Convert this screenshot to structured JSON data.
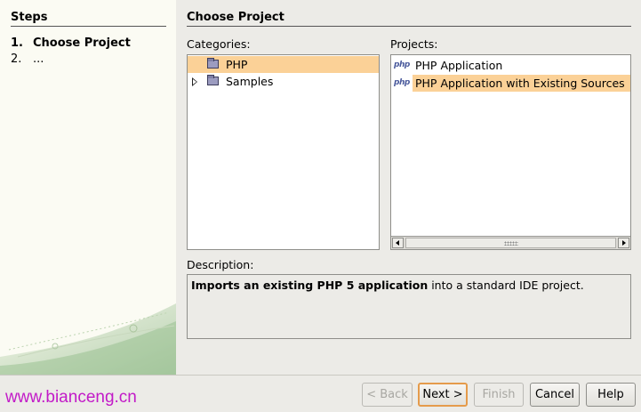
{
  "steps": {
    "title": "Steps",
    "items": [
      {
        "num": "1.",
        "label": "Choose Project"
      },
      {
        "num": "2.",
        "label": "..."
      }
    ]
  },
  "panel": {
    "title": "Choose Project",
    "categories_label": "Categories:",
    "projects_label": "Projects:",
    "description_label": "Description:"
  },
  "categories": [
    {
      "label": "PHP",
      "selected": true,
      "expandable": false
    },
    {
      "label": "Samples",
      "selected": false,
      "expandable": true
    }
  ],
  "projects": [
    {
      "label": "PHP Application",
      "icon": "php",
      "selected": false
    },
    {
      "label": "PHP Application with Existing Sources",
      "icon": "php",
      "selected": true
    }
  ],
  "description": {
    "bold": "Imports an existing PHP 5 application",
    "rest": " into a standard IDE project."
  },
  "buttons": {
    "back": "< Back",
    "next": "Next >",
    "finish": "Finish",
    "cancel": "Cancel",
    "help": "Help"
  },
  "watermark": "www.bianceng.cn",
  "colors": {
    "selection": "#fbd197",
    "watermark": "#c21ac8",
    "default_button_border": "#e59b4b"
  }
}
